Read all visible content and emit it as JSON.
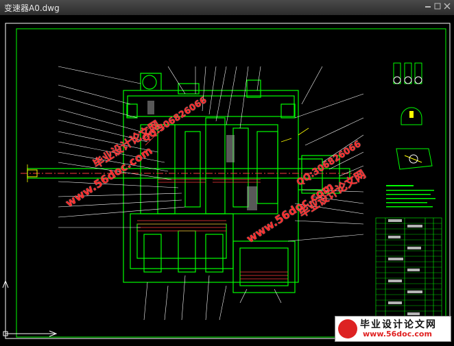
{
  "window": {
    "title": "变速器A0.dwg"
  },
  "watermarks": {
    "site_url": "www.56doc.com",
    "qq": "QQ:306826066",
    "brand": "毕业设计论文网"
  },
  "footer_logo": {
    "brand": "毕业设计论文网",
    "url": "www.56doc.com"
  },
  "colors": {
    "background": "#000000",
    "frame": "#ffffff",
    "outline": "#00ff00",
    "hatch": "#ff3b3b",
    "leader": "#ffffff",
    "accent": "#ffff00",
    "watermark": "#ff2a2a"
  }
}
